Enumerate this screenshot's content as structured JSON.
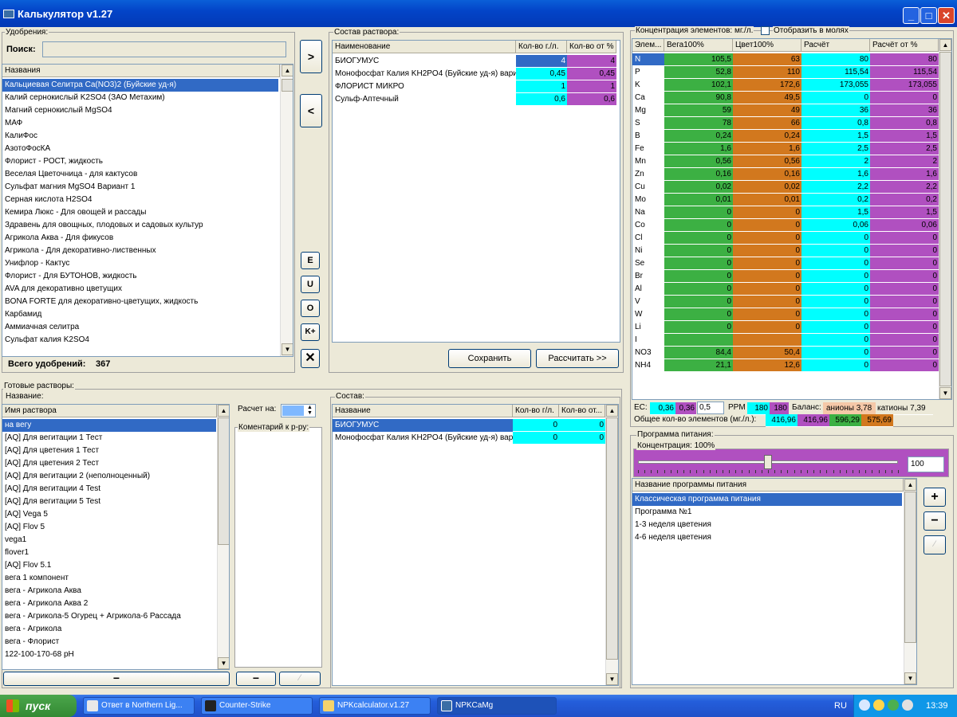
{
  "window": {
    "title": "Калькулятор v1.27"
  },
  "fertilizers": {
    "legend": "Удобрения:",
    "search_label": "Поиск:",
    "search_value": "",
    "column": "Названия",
    "items": [
      "Кальциевая Селитра Ca(NO3)2 (Буйские уд-я)",
      "Калий сернокислый K2SO4 (ЗАО Метахим)",
      "Магний сернокислый MgSO4",
      "МАФ",
      "КалиФос",
      "АзотоФосКА",
      "Флорист - РОСТ, жидкость",
      "Веселая Цветочница - для кактусов",
      "Сульфат магния MgSO4 Вариант 1",
      "Серная кислота H2SO4",
      "Кемира Люкс - Для овощей и рассады",
      "Здравень для овощных, плодовых и садовых культур",
      "Агрикола Аква - Для фикусов",
      "Агрикола - Для декоративно-лиственных",
      "Унифлор - Кактус",
      "Флорист - Для БУТОНОВ, жидкость",
      "AVA для декоративно цветущих",
      "BONA FORTE для декоративно-цветущих, жидкость",
      "Карбамид",
      "Аммиачная селитра",
      "Сульфат калия K2SO4"
    ],
    "total_label": "Всего удобрений:",
    "total": "367"
  },
  "mid_buttons": {
    "add": ">",
    "remove": "<",
    "e": "E",
    "u": "U",
    "o": "O",
    "k": "K+",
    "x": "✕"
  },
  "composition": {
    "legend": "Состав раствора:",
    "columns": [
      "Наименование",
      "Кол-во г./л.",
      "Кол-во от %"
    ],
    "rows": [
      {
        "name": "БИОГУМУС",
        "g": "4",
        "pct": "4"
      },
      {
        "name": "Монофосфат Калия KH2PO4 (Буйские уд-я) вари",
        "g": "0,45",
        "pct": "0,45"
      },
      {
        "name": "ФЛОРИСТ МИКРО",
        "g": "1",
        "pct": "1"
      },
      {
        "name": "Сульф-Аптечный",
        "g": "0,6",
        "pct": "0,6"
      }
    ],
    "save": "Сохранить",
    "calc": "Рассчитать >>"
  },
  "concentration": {
    "legend": "Концентрация элементов: мг./л.",
    "moles_label": "Отобразить в молях",
    "columns": [
      "Элем...",
      "Вега100%",
      "Цвет100%",
      "Расчёт",
      "Расчёт от %"
    ],
    "rows": [
      [
        "N",
        "105,5",
        "63",
        "80",
        "80"
      ],
      [
        "P",
        "52,8",
        "110",
        "115,54",
        "115,54"
      ],
      [
        "K",
        "102,1",
        "172,6",
        "173,055",
        "173,055"
      ],
      [
        "Ca",
        "90,8",
        "49,5",
        "0",
        "0"
      ],
      [
        "Mg",
        "59",
        "49",
        "36",
        "36"
      ],
      [
        "S",
        "78",
        "66",
        "0,8",
        "0,8"
      ],
      [
        "B",
        "0,24",
        "0,24",
        "1,5",
        "1,5"
      ],
      [
        "Fe",
        "1,6",
        "1,6",
        "2,5",
        "2,5"
      ],
      [
        "Mn",
        "0,56",
        "0,56",
        "2",
        "2"
      ],
      [
        "Zn",
        "0,16",
        "0,16",
        "1,6",
        "1,6"
      ],
      [
        "Cu",
        "0,02",
        "0,02",
        "2,2",
        "2,2"
      ],
      [
        "Mo",
        "0,01",
        "0,01",
        "0,2",
        "0,2"
      ],
      [
        "Na",
        "0",
        "0",
        "1,5",
        "1,5"
      ],
      [
        "Co",
        "0",
        "0",
        "0,06",
        "0,06"
      ],
      [
        "Cl",
        "0",
        "0",
        "0",
        "0"
      ],
      [
        "Ni",
        "0",
        "0",
        "0",
        "0"
      ],
      [
        "Se",
        "0",
        "0",
        "0",
        "0"
      ],
      [
        "Br",
        "0",
        "0",
        "0",
        "0"
      ],
      [
        "Al",
        "0",
        "0",
        "0",
        "0"
      ],
      [
        "V",
        "0",
        "0",
        "0",
        "0"
      ],
      [
        "W",
        "0",
        "0",
        "0",
        "0"
      ],
      [
        "Li",
        "0",
        "0",
        "0",
        "0"
      ],
      [
        "I",
        "",
        "",
        "0",
        "0"
      ],
      [
        "NO3",
        "84,4",
        "50,4",
        "0",
        "0"
      ],
      [
        "NH4",
        "21,1",
        "12,6",
        "0",
        "0"
      ]
    ],
    "colors": [
      "#00ffff",
      "#3cb043",
      "#d2781e",
      "#00ffff",
      "#b050c0"
    ],
    "ec_label": "EC:",
    "ec1": "0,36",
    "ec2": "0,36",
    "ec_spin": "0,5",
    "ppm_label": "PPM",
    "ppm1": "180",
    "ppm2": "180",
    "balance_label": "Баланс:",
    "anions": "анионы 3,78",
    "cations": "катионы 7,39",
    "total_label": "Общее кол-во элементов (мг./л.):",
    "totals": [
      "416,96",
      "416,96",
      "596,29",
      "575,69"
    ]
  },
  "ready": {
    "legend": "Готовые растворы:",
    "name_label": "Название:",
    "column": "Имя раствора",
    "items": [
      "на вегу",
      "[AQ] Для вегитации 1 Тест",
      "[AQ] Для цветения 1 Тест",
      "[AQ] Для цветения 2 Тест",
      "[AQ] Для вегитации 2 (неполноценный)",
      "[AQ] Для вегитации 4 Test",
      "[AQ] Для вегитации 5 Test",
      "[AQ] Vega 5",
      "[AQ] Flov 5",
      "vega1",
      "flover1",
      "[AQ] Flov 5.1",
      "вега 1 компонент",
      "вега - Агрикола Аква",
      "вега - Агрикола Аква 2",
      "вега - Агрикола-5 Огурец + Агрикола-6 Рассада",
      "вега - Агрикола",
      "вега - Флорист",
      "122-100-170-68 pH"
    ],
    "minus": "−",
    "calc_label": "Расчет на:",
    "comment_label": "Коментарий к р-ру:"
  },
  "ready_comp": {
    "legend": "Состав:",
    "columns": [
      "Название",
      "Кол-во г/л.",
      "Кол-во от..."
    ],
    "rows": [
      {
        "name": "БИОГУМУС",
        "g": "0",
        "pct": "0"
      },
      {
        "name": "Монофосфат Калия KH2PO4 (Буйские уд-я) вар",
        "g": "0",
        "pct": "0"
      }
    ]
  },
  "program": {
    "legend": "Программа питания:",
    "conc_label": "Концентрация: 100%",
    "slider_value": 0.5,
    "value": "100",
    "column": "Название программы питания",
    "items": [
      "Классическая программа питания",
      "Программа №1",
      "1-3 неделя цветения",
      "4-6 неделя цветения"
    ],
    "add": "+",
    "remove": "−"
  },
  "taskbar": {
    "start": "пуск",
    "tasks": [
      "Ответ в Northern Lig...",
      "Counter-Strike",
      "NPKcalculator.v1.27",
      "NPKCaMg"
    ],
    "lang": "RU",
    "time": "13:39"
  }
}
